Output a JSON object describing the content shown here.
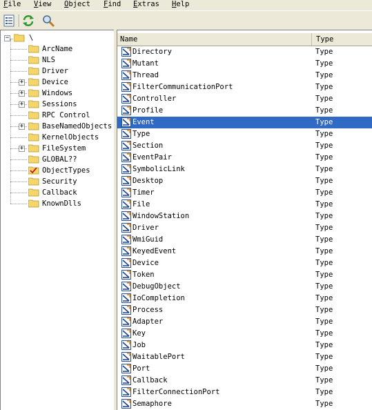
{
  "menu": [
    {
      "label": "File",
      "hotkey": "F",
      "rest": "ile"
    },
    {
      "label": "View",
      "hotkey": "V",
      "rest": "iew"
    },
    {
      "label": "Object",
      "hotkey": "O",
      "rest": "bject"
    },
    {
      "label": "Find",
      "hotkey": "F",
      "rest": "ind"
    },
    {
      "label": "Extras",
      "hotkey": "E",
      "rest": "xtras"
    },
    {
      "label": "Help",
      "hotkey": "H",
      "rest": "elp"
    }
  ],
  "toolbar": {
    "buttons": [
      "properties-icon",
      "refresh-icon",
      "find-icon"
    ]
  },
  "tree": {
    "root": "\\",
    "items": [
      {
        "label": "ArcName",
        "expandable": false,
        "icon": "folder-icon"
      },
      {
        "label": "NLS",
        "expandable": false,
        "icon": "folder-icon"
      },
      {
        "label": "Driver",
        "expandable": false,
        "icon": "folder-icon"
      },
      {
        "label": "Device",
        "expandable": true,
        "icon": "folder-icon"
      },
      {
        "label": "Windows",
        "expandable": true,
        "icon": "folder-icon"
      },
      {
        "label": "Sessions",
        "expandable": true,
        "icon": "folder-icon"
      },
      {
        "label": "RPC Control",
        "expandable": false,
        "icon": "folder-icon"
      },
      {
        "label": "BaseNamedObjects",
        "expandable": true,
        "icon": "folder-icon"
      },
      {
        "label": "KernelObjects",
        "expandable": false,
        "icon": "folder-icon"
      },
      {
        "label": "FileSystem",
        "expandable": true,
        "icon": "folder-icon"
      },
      {
        "label": "GLOBAL??",
        "expandable": false,
        "icon": "folder-icon"
      },
      {
        "label": "ObjectTypes",
        "expandable": false,
        "icon": "checked-folder-icon"
      },
      {
        "label": "Security",
        "expandable": false,
        "icon": "folder-icon"
      },
      {
        "label": "Callback",
        "expandable": false,
        "icon": "folder-icon"
      },
      {
        "label": "KnownDlls",
        "expandable": false,
        "icon": "folder-icon"
      }
    ]
  },
  "list": {
    "columns": [
      "Name",
      "Type"
    ],
    "selected_index": 6,
    "rows": [
      {
        "name": "Directory",
        "type": "Type"
      },
      {
        "name": "Mutant",
        "type": "Type"
      },
      {
        "name": "Thread",
        "type": "Type"
      },
      {
        "name": "FilterCommunicationPort",
        "type": "Type"
      },
      {
        "name": "Controller",
        "type": "Type"
      },
      {
        "name": "Profile",
        "type": "Type"
      },
      {
        "name": "Event",
        "type": "Type"
      },
      {
        "name": "Type",
        "type": "Type"
      },
      {
        "name": "Section",
        "type": "Type"
      },
      {
        "name": "EventPair",
        "type": "Type"
      },
      {
        "name": "SymbolicLink",
        "type": "Type"
      },
      {
        "name": "Desktop",
        "type": "Type"
      },
      {
        "name": "Timer",
        "type": "Type"
      },
      {
        "name": "File",
        "type": "Type"
      },
      {
        "name": "WindowStation",
        "type": "Type"
      },
      {
        "name": "Driver",
        "type": "Type"
      },
      {
        "name": "WmiGuid",
        "type": "Type"
      },
      {
        "name": "KeyedEvent",
        "type": "Type"
      },
      {
        "name": "Device",
        "type": "Type"
      },
      {
        "name": "Token",
        "type": "Type"
      },
      {
        "name": "DebugObject",
        "type": "Type"
      },
      {
        "name": "IoCompletion",
        "type": "Type"
      },
      {
        "name": "Process",
        "type": "Type"
      },
      {
        "name": "Adapter",
        "type": "Type"
      },
      {
        "name": "Key",
        "type": "Type"
      },
      {
        "name": "Job",
        "type": "Type"
      },
      {
        "name": "WaitablePort",
        "type": "Type"
      },
      {
        "name": "Port",
        "type": "Type"
      },
      {
        "name": "Callback",
        "type": "Type"
      },
      {
        "name": "FilterConnectionPort",
        "type": "Type"
      },
      {
        "name": "Semaphore",
        "type": "Type"
      }
    ]
  },
  "colors": {
    "selection": "#316ac5",
    "face": "#ece9d8",
    "folder": "#f5d66b"
  }
}
